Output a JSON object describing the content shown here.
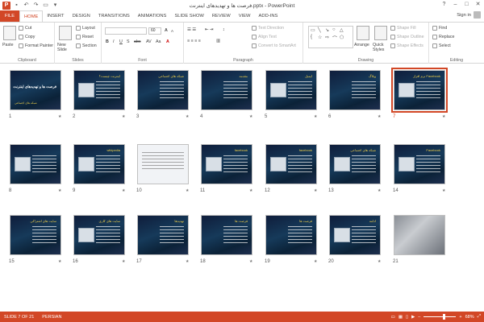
{
  "window": {
    "title": "فرصت ها و تهدیدهای اینترنت.pptx - PowerPoint",
    "app_logo": "P",
    "controls": [
      "?",
      "–",
      "□",
      "✕"
    ]
  },
  "tabs": [
    "FILE",
    "HOME",
    "INSERT",
    "DESIGN",
    "TRANSITIONS",
    "ANIMATIONS",
    "SLIDE SHOW",
    "REVIEW",
    "VIEW",
    "ADD-INS"
  ],
  "active_tab": "HOME",
  "signin": "Sign in",
  "ribbon": {
    "clipboard": {
      "label": "Clipboard",
      "paste": "Paste",
      "cut": "Cut",
      "copy": "Copy",
      "format_painter": "Format Painter"
    },
    "slides": {
      "label": "Slides",
      "new_slide": "New Slide",
      "layout": "Layout",
      "reset": "Reset",
      "section": "Section"
    },
    "font": {
      "label": "Font",
      "font_size": "60"
    },
    "paragraph": {
      "label": "Paragraph",
      "text_direction": "Text Direction",
      "align_text": "Align Text",
      "smartart": "Convert to SmartArt"
    },
    "drawing": {
      "label": "Drawing",
      "arrange": "Arrange",
      "quick_styles": "Quick Styles",
      "shape_fill": "Shape Fill",
      "shape_outline": "Shape Outline",
      "shape_effects": "Shape Effects"
    },
    "editing": {
      "label": "Editing",
      "find": "Find",
      "replace": "Replace",
      "select": "Select"
    }
  },
  "slides": [
    {
      "num": "1",
      "title": "فرصت ها و تهدیدهای اینترنت",
      "sub": "شبکه های اجتماعی",
      "kind": "cover"
    },
    {
      "num": "2",
      "title": "اینترنت چیست؟",
      "kind": "pic"
    },
    {
      "num": "3",
      "title": "شبکه های اجتماعی",
      "kind": "text"
    },
    {
      "num": "4",
      "title": "مقدمه",
      "kind": "text"
    },
    {
      "num": "5",
      "title": "ایمیل",
      "kind": "pic"
    },
    {
      "num": "6",
      "title": "وبلاگ",
      "kind": "text"
    },
    {
      "num": "7",
      "title": "نرم افزار Facebook",
      "kind": "pic",
      "selected": true
    },
    {
      "num": "8",
      "title": "",
      "kind": "pic"
    },
    {
      "num": "9",
      "title": "wikipedia",
      "kind": "pic"
    },
    {
      "num": "10",
      "title": "",
      "kind": "light"
    },
    {
      "num": "11",
      "title": "facebook",
      "kind": "pic"
    },
    {
      "num": "12",
      "title": "facebook",
      "kind": "pic"
    },
    {
      "num": "13",
      "title": "شبکه های اجتماعی",
      "kind": "pic"
    },
    {
      "num": "14",
      "title": "Facebook",
      "kind": "pic"
    },
    {
      "num": "15",
      "title": "سایت های اشتراکی",
      "kind": "text"
    },
    {
      "num": "16",
      "title": "سایت های کاری",
      "kind": "pic"
    },
    {
      "num": "17",
      "title": "تهدیدها",
      "kind": "text"
    },
    {
      "num": "18",
      "title": "فرصت ها",
      "kind": "text"
    },
    {
      "num": "19",
      "title": "فرصت ها",
      "kind": "text"
    },
    {
      "num": "20",
      "title": "ادامه",
      "kind": "pic"
    },
    {
      "num": "21",
      "title": "",
      "kind": "photo"
    }
  ],
  "status": {
    "slide_info": "SLIDE 7 OF 21",
    "language": "PERSIAN",
    "zoom": "68%"
  },
  "colors": {
    "accent": "#d24726",
    "slide_bg": "#12304d",
    "title_yellow": "#f0d04a"
  }
}
